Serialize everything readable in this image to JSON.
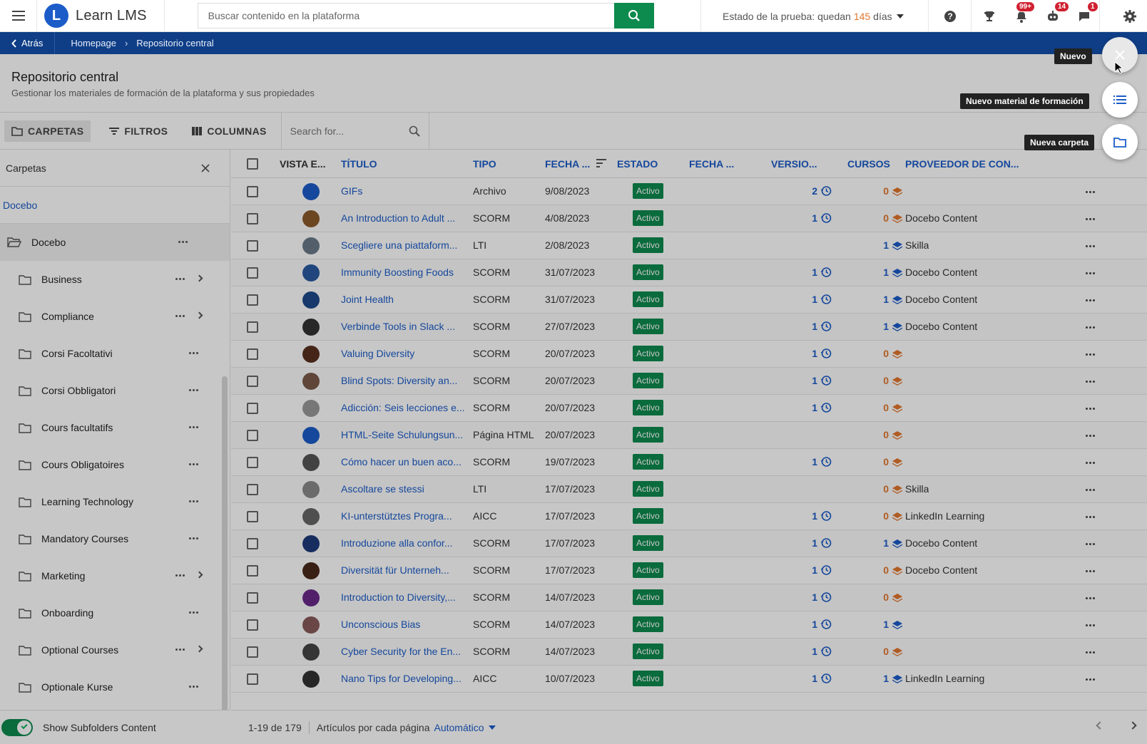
{
  "app": {
    "name": "Learn LMS"
  },
  "search": {
    "placeholder": "Buscar contenido en la plataforma"
  },
  "trial": {
    "prefix": "Estado de la prueba: quedan",
    "days": "145",
    "suffix": "días"
  },
  "notifications": {
    "bell": "99+",
    "gamification": "14",
    "messages": "1"
  },
  "breadcrumb": {
    "back": "Atrás",
    "items": [
      "Homepage",
      "Repositorio central"
    ]
  },
  "page": {
    "title": "Repositorio central",
    "subtitle": "Gestionar los materiales de formación de la plataforma y sus propiedades"
  },
  "toolbar": {
    "folders": "CARPETAS",
    "filters": "FILTROS",
    "columns": "COLUMNAS",
    "search_placeholder": "Search for..."
  },
  "sidebar": {
    "title": "Carpetas",
    "root_link": "Docebo",
    "root_folder": "Docebo",
    "folders": [
      {
        "name": "Business",
        "expandable": true
      },
      {
        "name": "Compliance",
        "expandable": true
      },
      {
        "name": "Corsi Facoltativi",
        "expandable": false
      },
      {
        "name": "Corsi Obbligatori",
        "expandable": false
      },
      {
        "name": "Cours facultatifs",
        "expandable": false
      },
      {
        "name": "Cours Obligatoires",
        "expandable": false
      },
      {
        "name": "Learning Technology",
        "expandable": false
      },
      {
        "name": "Mandatory Courses",
        "expandable": false
      },
      {
        "name": "Marketing",
        "expandable": true
      },
      {
        "name": "Onboarding",
        "expandable": false
      },
      {
        "name": "Optional Courses",
        "expandable": true
      },
      {
        "name": "Optionale Kurse",
        "expandable": false
      }
    ],
    "footer_toggle": "Show Subfolders Content"
  },
  "table": {
    "headers": {
      "preview": "VISTA E...",
      "title": "TÍTULO",
      "type": "TIPO",
      "date": "FECHA ...",
      "status": "ESTADO",
      "date2": "FECHA ...",
      "version": "VERSIO...",
      "courses": "CURSOS",
      "provider": "PROVEEDOR DE CON..."
    },
    "rows": [
      {
        "title": "GIFs",
        "type": "Archivo",
        "date": "9/08/2023",
        "status": "Activo",
        "version": "2",
        "courses": "0",
        "provider": "",
        "thumb": "#1b5cc8"
      },
      {
        "title": "An Introduction to Adult ...",
        "type": "SCORM",
        "date": "4/08/2023",
        "status": "Activo",
        "version": "1",
        "courses": "0",
        "provider": "Docebo Content",
        "thumb": "#8a5a2b"
      },
      {
        "title": "Scegliere una piattaform...",
        "type": "LTI",
        "date": "2/08/2023",
        "status": "Activo",
        "version": "",
        "courses": "1",
        "provider": "Skilla",
        "thumb": "#6a7a8a"
      },
      {
        "title": "Immunity Boosting Foods",
        "type": "SCORM",
        "date": "31/07/2023",
        "status": "Activo",
        "version": "1",
        "courses": "1",
        "provider": "Docebo Content",
        "thumb": "#2a5aa0"
      },
      {
        "title": "Joint Health",
        "type": "SCORM",
        "date": "31/07/2023",
        "status": "Activo",
        "version": "1",
        "courses": "1",
        "provider": "Docebo Content",
        "thumb": "#1e4a8a"
      },
      {
        "title": "Verbinde Tools in Slack ...",
        "type": "SCORM",
        "date": "27/07/2023",
        "status": "Activo",
        "version": "1",
        "courses": "1",
        "provider": "Docebo Content",
        "thumb": "#333333"
      },
      {
        "title": "Valuing Diversity",
        "type": "SCORM",
        "date": "20/07/2023",
        "status": "Activo",
        "version": "1",
        "courses": "0",
        "provider": "",
        "thumb": "#5a3020"
      },
      {
        "title": "Blind Spots: Diversity an...",
        "type": "SCORM",
        "date": "20/07/2023",
        "status": "Activo",
        "version": "1",
        "courses": "0",
        "provider": "",
        "thumb": "#7a5a4a"
      },
      {
        "title": "Adicción: Seis lecciones e...",
        "type": "SCORM",
        "date": "20/07/2023",
        "status": "Activo",
        "version": "1",
        "courses": "0",
        "provider": "",
        "thumb": "#999999"
      },
      {
        "title": "HTML-Seite Schulungsun...",
        "type": "Página HTML",
        "date": "20/07/2023",
        "status": "Activo",
        "version": "",
        "courses": "0",
        "provider": "",
        "thumb": "#1b5cc8"
      },
      {
        "title": "Cómo hacer un buen aco...",
        "type": "SCORM",
        "date": "19/07/2023",
        "status": "Activo",
        "version": "1",
        "courses": "0",
        "provider": "",
        "thumb": "#555555"
      },
      {
        "title": "Ascoltare se stessi",
        "type": "LTI",
        "date": "17/07/2023",
        "status": "Activo",
        "version": "",
        "courses": "0",
        "provider": "Skilla",
        "thumb": "#8a8a8a"
      },
      {
        "title": "KI-unterstütztes Progra...",
        "type": "AICC",
        "date": "17/07/2023",
        "status": "Activo",
        "version": "1",
        "courses": "0",
        "provider": "LinkedIn Learning",
        "thumb": "#666666"
      },
      {
        "title": "Introduzione alla confor...",
        "type": "SCORM",
        "date": "17/07/2023",
        "status": "Activo",
        "version": "1",
        "courses": "1",
        "provider": "Docebo Content",
        "thumb": "#1e3a7a"
      },
      {
        "title": "Diversität für Unterneh...",
        "type": "SCORM",
        "date": "17/07/2023",
        "status": "Activo",
        "version": "1",
        "courses": "0",
        "provider": "Docebo Content",
        "thumb": "#4a2a1a"
      },
      {
        "title": "Introduction to Diversity,...",
        "type": "SCORM",
        "date": "14/07/2023",
        "status": "Activo",
        "version": "1",
        "courses": "0",
        "provider": "",
        "thumb": "#6a2a8a"
      },
      {
        "title": "Unconscious Bias",
        "type": "SCORM",
        "date": "14/07/2023",
        "status": "Activo",
        "version": "1",
        "courses": "1",
        "provider": "",
        "thumb": "#8a5a5a"
      },
      {
        "title": "Cyber Security for the En...",
        "type": "SCORM",
        "date": "14/07/2023",
        "status": "Activo",
        "version": "1",
        "courses": "0",
        "provider": "",
        "thumb": "#444444"
      },
      {
        "title": "Nano Tips for Developing...",
        "type": "AICC",
        "date": "10/07/2023",
        "status": "Activo",
        "version": "1",
        "courses": "1",
        "provider": "LinkedIn Learning",
        "thumb": "#333333"
      }
    ]
  },
  "footer": {
    "range": "1-19 de 179",
    "per_page_label": "Artículos por cada página",
    "per_page_value": "Automático"
  },
  "fab": {
    "main_label": "Nuevo",
    "training_label": "Nuevo material de formación",
    "folder_label": "Nueva carpeta"
  },
  "colors": {
    "primary": "#1b5cc8",
    "nav": "#0f3e87",
    "success": "#0d8a4d",
    "accent": "#e2762d"
  }
}
